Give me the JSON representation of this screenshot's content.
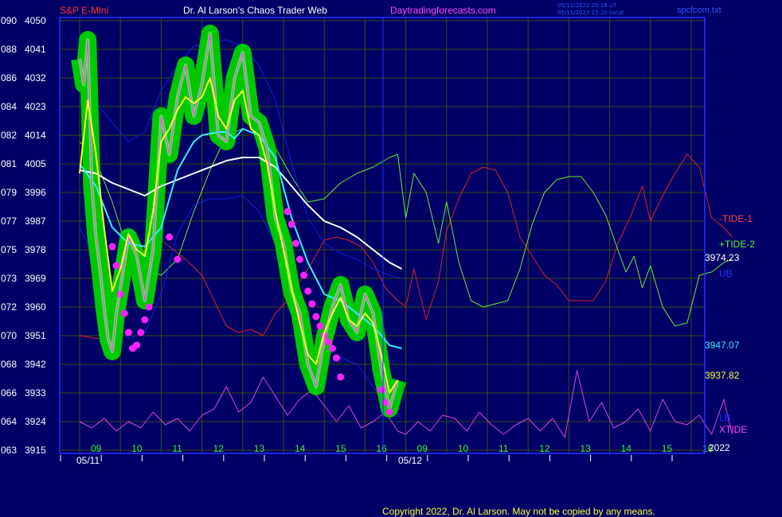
{
  "header": {
    "symbol": "S&P E-Mini",
    "site_title": "Dr. Al Larson's Chaos Trader Web",
    "site_url": "Daytradingforecasts.com",
    "ts_line1": "05/11/2022 20:18 UT",
    "ts_line2": "05/11/2022 15:20 Local",
    "filename": "spcfcom.txt"
  },
  "footer": {
    "copyright": "Copyright 2022, Dr. Al Larson. May not be copied by any means.",
    "year": "2022"
  },
  "colors": {
    "background": "#000066",
    "grid": "#3a4d10",
    "frame": "#2233ff",
    "price": "#ff44ff",
    "halo": "#00c800",
    "fast_ma": "#ffff33",
    "slow_ma": "#33eeff",
    "long_ma": "#ffffff",
    "bands": "#1122dd",
    "tide1": "#dd2222",
    "tide2": "#66ee33",
    "xtide": "#dd44dd",
    "markers": "#ff22ff"
  },
  "chart_data": {
    "type": "line",
    "y_ticks": [
      {
        "left": "090",
        "right": "4050"
      },
      {
        "left": "088",
        "right": "4041"
      },
      {
        "left": "086",
        "right": "4032"
      },
      {
        "left": "084",
        "right": "4023"
      },
      {
        "left": "082",
        "right": "4014"
      },
      {
        "left": "081",
        "right": "4005"
      },
      {
        "left": "079",
        "right": "3996"
      },
      {
        "left": "077",
        "right": "3987"
      },
      {
        "left": "075",
        "right": "3978"
      },
      {
        "left": "073",
        "right": "3969"
      },
      {
        "left": "072",
        "right": "3960"
      },
      {
        "left": "070",
        "right": "3951"
      },
      {
        "left": "068",
        "right": "3942"
      },
      {
        "left": "066",
        "right": "3933"
      },
      {
        "left": "064",
        "right": "3924"
      },
      {
        "left": "063",
        "right": "3915"
      }
    ],
    "ylim": [
      3915,
      4050
    ],
    "hours": [
      "09",
      "10",
      "11",
      "12",
      "13",
      "14",
      "15",
      "16",
      "09",
      "10",
      "11",
      "12",
      "13",
      "14",
      "15",
      "16"
    ],
    "dates": [
      "05/11",
      "05/12"
    ],
    "right_labels": [
      {
        "text": "-TIDE-1",
        "color": "#ff4444"
      },
      {
        "text": "+TIDE-2",
        "color": "#66ee33"
      },
      {
        "text": "3974.23",
        "color": "#ffffff"
      },
      {
        "text": "UB",
        "color": "#2233ff"
      },
      {
        "text": "3947.07",
        "color": "#33eeff"
      },
      {
        "text": "3937.82",
        "color": "#ffff33"
      },
      {
        "text": "LB",
        "color": "#2233ff"
      },
      {
        "text": "XTIDE",
        "color": "#ff44ff"
      }
    ],
    "series": [
      {
        "name": "price",
        "x": [
          0,
          0.1,
          0.2,
          0.3,
          0.4,
          0.5,
          0.6,
          0.7,
          0.8,
          0.9,
          1,
          1.2,
          1.4,
          1.6,
          1.8,
          2,
          2.2,
          2.4,
          2.6,
          2.8,
          3,
          3.2,
          3.4,
          3.6,
          3.8,
          4,
          4.2,
          4.4,
          4.6,
          4.8,
          5,
          5.2,
          5.4,
          5.6,
          5.8,
          6,
          6.2,
          6.4,
          6.6,
          6.8,
          7,
          7.2,
          7.4,
          7.6,
          7.8
        ],
        "values": [
          4038,
          4030,
          4044,
          3998,
          3982,
          3972,
          3960,
          3950,
          3946,
          3958,
          3966,
          3982,
          3976,
          3962,
          3978,
          4020,
          4008,
          4026,
          4036,
          4020,
          4030,
          4046,
          4014,
          4012,
          4032,
          4040,
          4020,
          4018,
          4010,
          3988,
          3980,
          3965,
          3958,
          3942,
          3935,
          3950,
          3960,
          3967,
          3956,
          3952,
          3964,
          3958,
          3940,
          3928,
          3937
        ]
      },
      {
        "name": "fast_ma",
        "x": [
          0,
          0.2,
          0.4,
          0.6,
          0.8,
          1,
          1.2,
          1.4,
          1.6,
          1.8,
          2,
          2.2,
          2.4,
          2.6,
          2.8,
          3,
          3.2,
          3.4,
          3.6,
          3.8,
          4,
          4.2,
          4.4,
          4.6,
          4.8,
          5,
          5.2,
          5.4,
          5.6,
          5.8,
          6,
          6.2,
          6.4,
          6.6,
          6.8,
          7,
          7.2,
          7.4,
          7.6,
          7.8
        ],
        "values": [
          4002,
          4025,
          4008,
          3985,
          3965,
          3972,
          3983,
          3978,
          3976,
          3990,
          4012,
          4016,
          4022,
          4026,
          4024,
          4026,
          4032,
          4020,
          4016,
          4025,
          4028,
          4016,
          4014,
          4005,
          3990,
          3978,
          3966,
          3955,
          3945,
          3942,
          3952,
          3958,
          3963,
          3956,
          3954,
          3958,
          3955,
          3945,
          3933,
          3937
        ]
      },
      {
        "name": "slow_ma",
        "x": [
          0,
          0.4,
          0.8,
          1.2,
          1.6,
          2,
          2.4,
          2.8,
          3,
          3.4,
          3.6,
          3.8,
          4,
          4.4,
          4.8,
          5.2,
          5.6,
          6,
          6.4,
          6.8,
          7.2,
          7.6,
          7.9
        ],
        "values": [
          4005,
          3998,
          3985,
          3980,
          3979,
          3985,
          4003,
          4012,
          4014,
          4015,
          4015,
          4013,
          4016,
          4014,
          4007,
          3988,
          3974,
          3964,
          3962,
          3958,
          3954,
          3948,
          3947
        ]
      },
      {
        "name": "long_ma",
        "x": [
          0,
          0.4,
          0.8,
          1.2,
          1.6,
          2,
          2.4,
          2.8,
          3.2,
          3.6,
          4,
          4.4,
          4.8,
          5.2,
          5.6,
          6,
          6.4,
          6.8,
          7.2,
          7.6,
          7.9
        ],
        "values": [
          4003,
          4002,
          3999,
          3997,
          3995,
          3998,
          4000,
          4002,
          4004,
          4006,
          4007,
          4007,
          4004,
          3998,
          3992,
          3987,
          3985,
          3982,
          3978,
          3974,
          3972
        ]
      },
      {
        "name": "UB",
        "x": [
          0,
          0.4,
          0.8,
          1.2,
          1.6,
          2,
          2.4,
          2.8,
          3.2,
          3.6,
          4,
          4.4,
          4.8,
          5.2,
          5.6,
          6,
          6.4,
          6.8,
          7.2,
          7.6,
          7.9
        ],
        "values": [
          4025,
          4024,
          4018,
          4012,
          4015,
          4028,
          4036,
          4042,
          4043,
          4044,
          4042,
          4036,
          4025,
          4005,
          3988,
          3980,
          3977,
          3975,
          3972,
          3970,
          3969
        ]
      },
      {
        "name": "LB",
        "x": [
          0,
          0.4,
          0.8,
          1.2,
          1.6,
          2,
          2.4,
          2.8,
          3.2,
          3.6,
          4,
          4.4,
          4.8,
          5.2,
          5.6,
          6,
          6.4,
          6.8,
          7.2,
          7.6,
          7.9
        ],
        "values": [
          3985,
          3975,
          3958,
          3950,
          3952,
          3964,
          3983,
          3992,
          3994,
          3994,
          3995,
          3990,
          3980,
          3960,
          3948,
          3942,
          3944,
          3942,
          3935,
          3928,
          3925
        ]
      },
      {
        "name": "-TIDE-1",
        "x": [
          0,
          0.5,
          0.8,
          1,
          1.2,
          1.5,
          1.8,
          2,
          2.3,
          2.6,
          3,
          3.3,
          3.6,
          3.9,
          4.2,
          4.5,
          4.8,
          5.1,
          5.4,
          5.7,
          6,
          6.3,
          6.6,
          6.9,
          7.2,
          7.5,
          7.8,
          8,
          8.2,
          8.5,
          8.8,
          9,
          9.3,
          9.6,
          9.9,
          10.2,
          10.5,
          10.8,
          11.1,
          11.4,
          11.7,
          12,
          12.3,
          12.6,
          12.9,
          13.2,
          13.5,
          13.8,
          14,
          14.3,
          14.6,
          14.9,
          15.2,
          15.5,
          15.8,
          16
        ],
        "values": [
          3951,
          3950,
          3958,
          3974,
          3978,
          3976,
          3979,
          3981,
          3978,
          3975,
          3970,
          3962,
          3954,
          3952,
          3953,
          3951,
          3958,
          3962,
          3968,
          3974,
          3981,
          3982,
          3981,
          3979,
          3974,
          3966,
          3962,
          3960,
          3972,
          3956,
          3968,
          3984,
          3994,
          4002,
          4004,
          4003,
          3996,
          3982,
          3976,
          3970,
          3967,
          3962,
          3962,
          3962,
          3968,
          3980,
          3988,
          3998,
          3987,
          3995,
          4002,
          4008,
          4004,
          3988,
          3985,
          3982
        ]
      },
      {
        "name": "+TIDE-2",
        "x": [
          0,
          0.4,
          0.8,
          1.2,
          1.6,
          2,
          2.4,
          2.8,
          3.2,
          3.6,
          4,
          4.4,
          4.8,
          5.2,
          5.6,
          6,
          6.4,
          6.8,
          7.2,
          7.6,
          7.8,
          8,
          8.2,
          8.5,
          8.8,
          9,
          9.3,
          9.6,
          9.9,
          10.2,
          10.5,
          10.8,
          11.1,
          11.4,
          11.7,
          12,
          12.3,
          12.6,
          12.9,
          13.2,
          13.4,
          13.6,
          13.8,
          14,
          14.3,
          14.6,
          14.9,
          15.2,
          15.5,
          15.8,
          16
        ],
        "values": [
          4012,
          4006,
          3993,
          3977,
          3972,
          3970,
          3975,
          3990,
          4003,
          4014,
          4016,
          4014,
          4010,
          4001,
          3993,
          3994,
          3999,
          4002,
          4004,
          4007,
          4008,
          3988,
          4002,
          3996,
          3980,
          3993,
          3974,
          3962,
          3960,
          3961,
          3962,
          3972,
          3986,
          3996,
          4000,
          4001,
          4001,
          3996,
          3989,
          3978,
          3971,
          3976,
          3966,
          3973,
          3960,
          3954,
          3955,
          3970,
          3971,
          3974,
          3975
        ]
      },
      {
        "name": "XTIDE",
        "x": [
          0,
          0.3,
          0.6,
          0.9,
          1.2,
          1.5,
          1.8,
          2.1,
          2.4,
          2.7,
          3,
          3.3,
          3.6,
          3.9,
          4.2,
          4.5,
          4.8,
          5.1,
          5.4,
          5.7,
          6,
          6.3,
          6.6,
          6.9,
          7.2,
          7.5,
          7.8,
          8,
          8.3,
          8.6,
          8.9,
          9.2,
          9.5,
          9.8,
          10.1,
          10.4,
          10.7,
          11,
          11.3,
          11.6,
          11.9,
          12.2,
          12.5,
          12.8,
          13.1,
          13.4,
          13.7,
          14,
          14.3,
          14.6,
          14.9,
          15.2,
          15.5,
          15.8,
          16
        ],
        "values": [
          3924,
          3922,
          3925,
          3921,
          3924,
          3922,
          3927,
          3923,
          3925,
          3921,
          3926,
          3928,
          3935,
          3927,
          3930,
          3938,
          3932,
          3926,
          3931,
          3934,
          3929,
          3924,
          3929,
          3922,
          3924,
          3927,
          3921,
          3920,
          3924,
          3921,
          3926,
          3925,
          3921,
          3927,
          3923,
          3920,
          3923,
          3925,
          3921,
          3925,
          3919,
          3940,
          3924,
          3930,
          3922,
          3924,
          3928,
          3921,
          3931,
          3924,
          3923,
          3926,
          3920,
          3931,
          3920
        ]
      }
    ],
    "markers": {
      "x": [
        0.8,
        0.9,
        1,
        1.1,
        1.2,
        1.3,
        1.4,
        1.5,
        1.6,
        1.7,
        2.2,
        2.4,
        5.1,
        5.2,
        5.3,
        5.4,
        5.5,
        5.6,
        5.7,
        5.8,
        5.9,
        6,
        6.1,
        6.2,
        6.3,
        6.4,
        7.4,
        7.5,
        7.6
      ],
      "values": [
        3979,
        3973,
        3964,
        3958,
        3952,
        3947,
        3948,
        3952,
        3956,
        3960,
        3982,
        3975,
        3990,
        3986,
        3980,
        3975,
        3970,
        3965,
        3961,
        3957,
        3954,
        3951,
        3949,
        3947,
        3944,
        3938,
        3934,
        3930,
        3927
      ]
    }
  }
}
